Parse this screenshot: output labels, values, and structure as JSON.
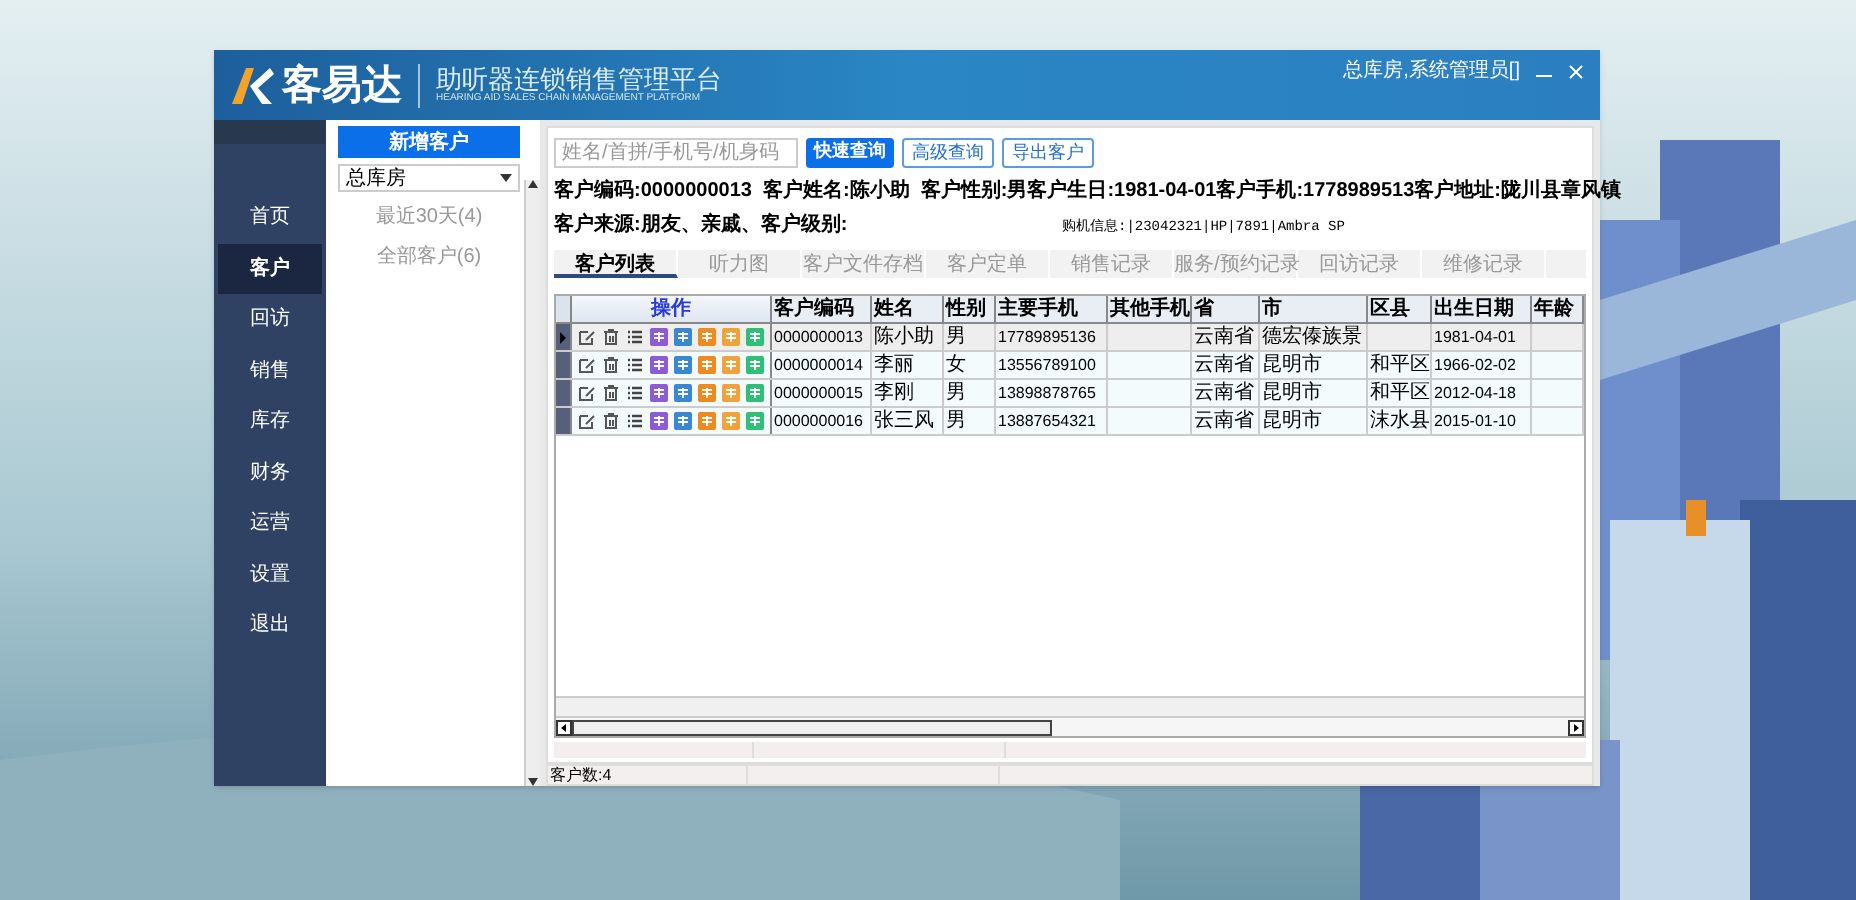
{
  "title_bar": {
    "brand": "客易达",
    "subtitle": "助听器连锁销售管理平台",
    "subtitle_en": "HEARING AID SALES CHAIN MANAGEMENT PLATFORM",
    "user": "总库房,系统管理员[]"
  },
  "sidebar": {
    "items": [
      {
        "label": "首页",
        "selected": false
      },
      {
        "label": "客户",
        "selected": true
      },
      {
        "label": "回访",
        "selected": false
      },
      {
        "label": "销售",
        "selected": false
      },
      {
        "label": "库存",
        "selected": false
      },
      {
        "label": "财务",
        "selected": false
      },
      {
        "label": "运营",
        "selected": false
      },
      {
        "label": "设置",
        "selected": false
      },
      {
        "label": "退出",
        "selected": false
      }
    ]
  },
  "left_panel": {
    "new_button": "新增客户",
    "store_select": "总库房",
    "filters": [
      "最近30天(4)",
      "全部客户(6)"
    ]
  },
  "toolbar": {
    "search": {
      "placeholder": "姓名/首拼/手机号/机身码"
    },
    "buttons": [
      {
        "label": "快速查询",
        "kind": "primary"
      },
      {
        "label": "高级查询",
        "kind": "outline"
      },
      {
        "label": "导出客户",
        "kind": "outline"
      }
    ]
  },
  "info": {
    "line1_left": "客户编码:0000000013  客户姓名:陈小助  客户性别:男",
    "line1_right": "客户生日:1981-04-01客户手机:1778989513客户地址:陇川县章风镇",
    "line2_left": "客户来源:朋友、亲戚、客户级别:",
    "line2_right": "购机信息:|23042321|HP|7891|Ambra SP"
  },
  "tabs": [
    {
      "label": "客户列表",
      "selected": true
    },
    {
      "label": "听力图",
      "selected": false
    },
    {
      "label": "客户文件存档",
      "selected": false
    },
    {
      "label": "客户定单",
      "selected": false
    },
    {
      "label": "销售记录",
      "selected": false
    },
    {
      "label": "服务/预约记录",
      "selected": false
    },
    {
      "label": "回访记录",
      "selected": false
    },
    {
      "label": "维修记录",
      "selected": false
    }
  ],
  "table": {
    "action_header": "操作",
    "columns": [
      "客户编码",
      "姓名",
      "性别",
      "主要手机",
      "其他手机",
      "省",
      "市",
      "区县",
      "出生日期",
      "年龄"
    ],
    "rows": [
      {
        "selected": true,
        "cells": [
          "0000000013",
          "陈小助",
          "男",
          "17789895136",
          "",
          "云南省",
          "德宏傣族景",
          "",
          "1981-04-01",
          ""
        ]
      },
      {
        "selected": false,
        "cells": [
          "0000000014",
          "李丽",
          "女",
          "13556789100",
          "",
          "云南省",
          "昆明市",
          "和平区",
          "1966-02-02",
          ""
        ]
      },
      {
        "selected": false,
        "cells": [
          "0000000015",
          "李刚",
          "男",
          "13898878765",
          "",
          "云南省",
          "昆明市",
          "和平区",
          "2012-04-18",
          ""
        ]
      },
      {
        "selected": false,
        "cells": [
          "0000000016",
          "张三风",
          "男",
          "13887654321",
          "",
          "云南省",
          "昆明市",
          "沫水县",
          "2015-01-10",
          ""
        ]
      }
    ]
  },
  "status_bar": {
    "count": "客户数:4"
  }
}
